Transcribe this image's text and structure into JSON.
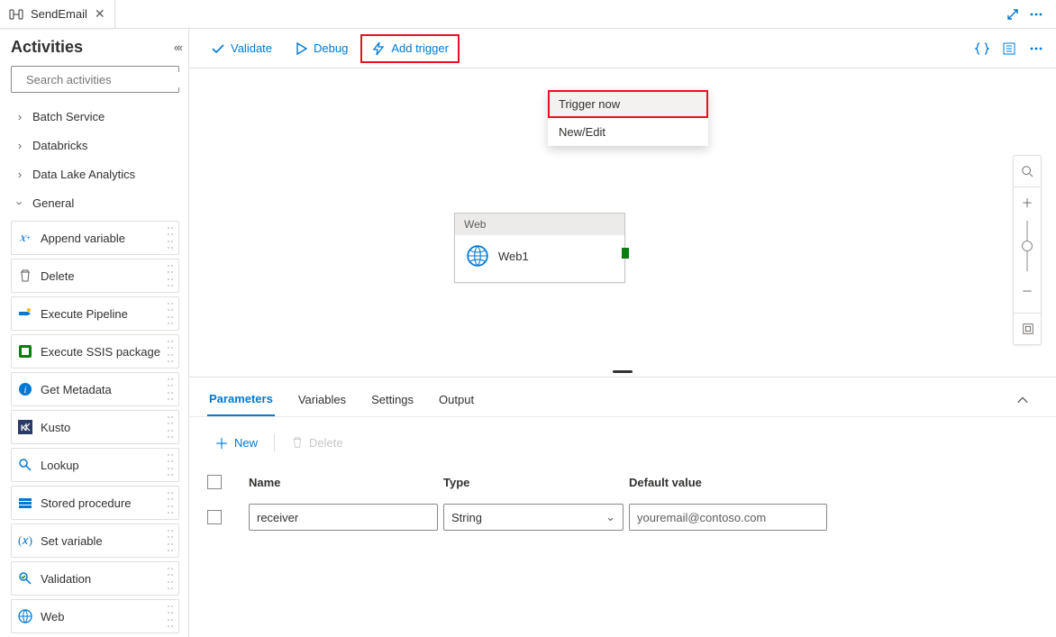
{
  "tab": {
    "title": "SendEmail"
  },
  "sidebar": {
    "title": "Activities",
    "search_placeholder": "Search activities",
    "groups": [
      {
        "label": "Batch Service",
        "expanded": false
      },
      {
        "label": "Databricks",
        "expanded": false
      },
      {
        "label": "Data Lake Analytics",
        "expanded": false
      },
      {
        "label": "General",
        "expanded": true
      }
    ],
    "activities": [
      {
        "label": "Append variable",
        "icon": "var-plus"
      },
      {
        "label": "Delete",
        "icon": "trash"
      },
      {
        "label": "Execute Pipeline",
        "icon": "pipe-run"
      },
      {
        "label": "Execute SSIS package",
        "icon": "ssis"
      },
      {
        "label": "Get Metadata",
        "icon": "info"
      },
      {
        "label": "Kusto",
        "icon": "kusto"
      },
      {
        "label": "Lookup",
        "icon": "lookup"
      },
      {
        "label": "Stored procedure",
        "icon": "sproc"
      },
      {
        "label": "Set variable",
        "icon": "var-set"
      },
      {
        "label": "Validation",
        "icon": "validate"
      },
      {
        "label": "Web",
        "icon": "globe"
      }
    ]
  },
  "toolbar": {
    "validate": "Validate",
    "debug": "Debug",
    "add_trigger": "Add trigger"
  },
  "trigger_menu": {
    "trigger_now": "Trigger now",
    "new_edit": "New/Edit"
  },
  "canvas": {
    "node_type": "Web",
    "node_name": "Web1"
  },
  "panel": {
    "tabs": {
      "parameters": "Parameters",
      "variables": "Variables",
      "settings": "Settings",
      "output": "Output"
    },
    "actions": {
      "new": "New",
      "delete": "Delete"
    },
    "columns": {
      "name": "Name",
      "type": "Type",
      "default": "Default value"
    },
    "rows": [
      {
        "name": "receiver",
        "type": "String",
        "default": "youremail@contoso.com"
      }
    ]
  }
}
